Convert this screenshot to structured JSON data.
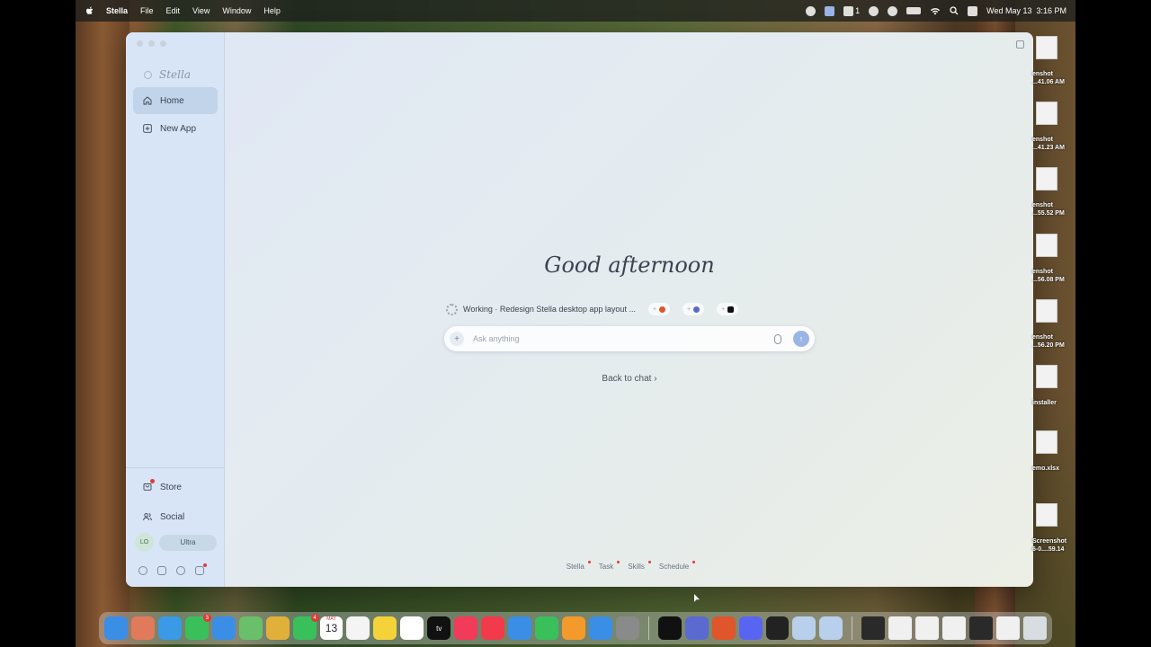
{
  "menubar": {
    "app_name": "Stella",
    "items": [
      "File",
      "Edit",
      "View",
      "Window",
      "Help"
    ],
    "status_icons": [
      "record-icon",
      "finder-icon",
      "clipboard-icon",
      "dot-icon",
      "play-icon",
      "battery-icon",
      "wifi-icon",
      "search-icon",
      "control-center-icon"
    ],
    "clipboard_count": "1",
    "datetime": "Wed May 13  3:16 PM"
  },
  "sidebar": {
    "logo": "Stella",
    "nav": [
      {
        "label": "Home",
        "icon": "home-icon",
        "active": true
      },
      {
        "label": "New App",
        "icon": "plus-square-icon",
        "active": false
      }
    ],
    "bottom": [
      {
        "label": "Store",
        "icon": "bag-icon",
        "has_badge": true
      },
      {
        "label": "Social",
        "icon": "people-icon",
        "has_badge": false
      }
    ],
    "user": {
      "initials": "LO",
      "plan": "Ultra"
    },
    "tools": [
      "settings-icon",
      "box-icon",
      "palette-icon",
      "notes-icon"
    ]
  },
  "main": {
    "greeting": "Good afternoon",
    "task": {
      "text": "Working · Redesign Stella desktop app layout ...",
      "chips": [
        {
          "icon": "brave-icon",
          "color": "#e0552a"
        },
        {
          "icon": "stella-icon",
          "color": "#5a6ad0"
        },
        {
          "icon": "terminal-icon",
          "color": "#111111"
        }
      ]
    },
    "ask": {
      "placeholder": "Ask anything",
      "plus": "+",
      "send": "↑"
    },
    "back_link": "Back to chat ›",
    "tabs": [
      "Stella",
      "Task",
      "Skills",
      "Schedule"
    ]
  },
  "desktop": {
    "icons": [
      {
        "label_top": "enshot",
        "label_bottom": "...41.06 AM"
      },
      {
        "label_top": "enshot",
        "label_bottom": "...41.23 AM"
      },
      {
        "label_top": "enshot",
        "label_bottom": "...55.52 PM"
      },
      {
        "label_top": "enshot",
        "label_bottom": "...56.08 PM"
      },
      {
        "label_top": "enshot",
        "label_bottom": "...56.20 PM"
      },
      {
        "label_top": "installer",
        "label_bottom": ""
      },
      {
        "label_top": "emo.xlsx",
        "label_bottom": ""
      },
      {
        "label_top": "Screenshot",
        "label_bottom": "6-0....59.14"
      }
    ]
  },
  "dock": {
    "apps": [
      {
        "name": "finder-icon",
        "color": "#3a8ee6"
      },
      {
        "name": "launchpad-icon",
        "color": "#e07a5a"
      },
      {
        "name": "safari-icon",
        "color": "#3a9ae6"
      },
      {
        "name": "messages-icon",
        "color": "#3ac05a",
        "badge": "3"
      },
      {
        "name": "mail-icon",
        "color": "#3a8ee6"
      },
      {
        "name": "maps-icon",
        "color": "#6ac06a"
      },
      {
        "name": "photos-icon",
        "color": "#e0b03a"
      },
      {
        "name": "facetime-icon",
        "color": "#3ac05a",
        "badge": "4"
      },
      {
        "name": "calendar-icon",
        "color": "#ffffff"
      },
      {
        "name": "reminders-icon",
        "color": "#f4f4f4"
      },
      {
        "name": "notes-icon",
        "color": "#f4d23a"
      },
      {
        "name": "freeform-icon",
        "color": "#ffffff"
      },
      {
        "name": "tv-icon",
        "color": "#111111"
      },
      {
        "name": "music-icon",
        "color": "#f23a5a"
      },
      {
        "name": "news-icon",
        "color": "#f23a4a"
      },
      {
        "name": "keynote-icon",
        "color": "#3a8ee6"
      },
      {
        "name": "numbers-icon",
        "color": "#3ac05a"
      },
      {
        "name": "pages-icon",
        "color": "#f49a2a"
      },
      {
        "name": "app-store-icon",
        "color": "#3a8ee6"
      },
      {
        "name": "system-settings-icon",
        "color": "#8a8a8a"
      },
      {
        "name": "terminal-icon",
        "color": "#111111"
      },
      {
        "name": "stella-icon",
        "color": "#5a6ad0"
      },
      {
        "name": "brave-icon",
        "color": "#e0552a"
      },
      {
        "name": "discord-icon",
        "color": "#5865f2"
      },
      {
        "name": "cursor-icon",
        "color": "#222222"
      },
      {
        "name": "stella-preview-icon",
        "color": "#b8d0ec"
      },
      {
        "name": "stella-preview-icon-2",
        "color": "#b8d0ec"
      }
    ],
    "recents": [
      {
        "name": "recent-window-1",
        "color": "#2a2a2a"
      },
      {
        "name": "recent-window-2",
        "color": "#f0f0f0"
      },
      {
        "name": "recent-window-3",
        "color": "#f0f0f0"
      },
      {
        "name": "recent-window-4",
        "color": "#f0f0f0"
      },
      {
        "name": "recent-window-5",
        "color": "#2a2a2a"
      },
      {
        "name": "recent-window-6",
        "color": "#f0f0f0"
      },
      {
        "name": "trash-icon",
        "color": "#d8dde2"
      }
    ],
    "calendar_month": "MAY",
    "calendar_day": "13",
    "tv_label": "tv"
  }
}
